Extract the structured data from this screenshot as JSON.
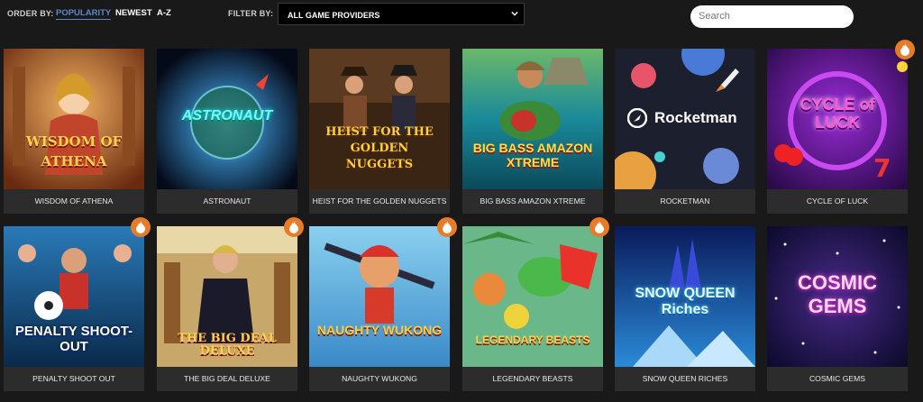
{
  "toolbar": {
    "order_by_label": "ORDER BY:",
    "sort_options": [
      "POPULARITY",
      "NEWEST",
      "A-Z"
    ],
    "active_sort": "POPULARITY",
    "filter_label": "FILTER BY:",
    "provider_selected": "ALL GAME PROVIDERS",
    "search_placeholder": "Search"
  },
  "accent_color": "#e77b28",
  "games": [
    {
      "name": "WISDOM OF ATHENA",
      "logo": "WISDOM OF ATHENA",
      "hot": false
    },
    {
      "name": "ASTRONAUT",
      "logo": "ASTRONAUT",
      "hot": false
    },
    {
      "name": "HEIST FOR THE GOLDEN NUGGETS",
      "logo": "HEIST FOR THE GOLDEN NUGGETS",
      "hot": false
    },
    {
      "name": "BIG BASS AMAZON XTREME",
      "logo": "BIG BASS AMAZON XTREME",
      "hot": false
    },
    {
      "name": "ROCKETMAN",
      "logo": "Rocketman",
      "hot": false
    },
    {
      "name": "CYCLE OF LUCK",
      "logo": "CYCLE of LUCK",
      "hot": true
    },
    {
      "name": "PENALTY SHOOT OUT",
      "logo": "PENALTY SHOOT-OUT",
      "hot": true
    },
    {
      "name": "THE BIG DEAL DELUXE",
      "logo": "THE BIG DEAL DELUXE",
      "hot": true
    },
    {
      "name": "NAUGHTY WUKONG",
      "logo": "NAUGHTY WUKONG",
      "hot": true
    },
    {
      "name": "LEGENDARY BEASTS",
      "logo": "LEGENDARY BEASTS",
      "hot": true
    },
    {
      "name": "SNOW QUEEN RICHES",
      "logo": "SNOW QUEEN Riches",
      "hot": false
    },
    {
      "name": "COSMIC GEMS",
      "logo": "COSMIC GEMS",
      "hot": false
    }
  ]
}
